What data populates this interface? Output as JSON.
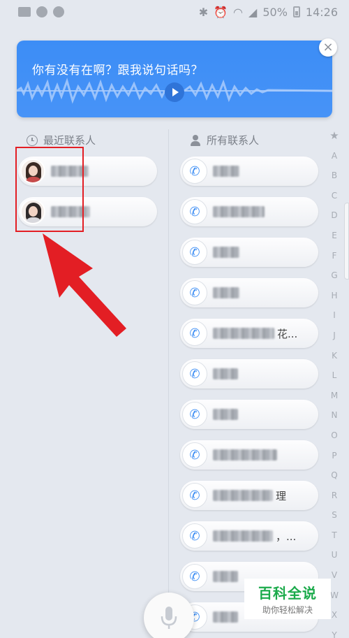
{
  "status_bar": {
    "battery": "50%",
    "time": "14:26",
    "left_icons": [
      "image-icon",
      "wechat-icon",
      "wechat-icon"
    ],
    "right_icons": [
      "bluetooth-icon",
      "alarm-icon",
      "wifi-icon",
      "signal-icon",
      "battery-icon"
    ]
  },
  "voice_card": {
    "text": "你有没有在啊？跟我说句话吗？",
    "accent": "#3c8df6"
  },
  "recent": {
    "header": "最近联系人",
    "items": [
      {
        "avatar": "avatar-woman-red"
      },
      {
        "avatar": "avatar-woman-white"
      }
    ]
  },
  "contacts": {
    "header": "所有联系人",
    "items": [
      {
        "tail": ""
      },
      {
        "tail": ""
      },
      {
        "tail": ""
      },
      {
        "tail": ""
      },
      {
        "tail": "花..."
      },
      {
        "tail": ""
      },
      {
        "tail": ""
      },
      {
        "tail": ""
      },
      {
        "tail": "理"
      },
      {
        "tail": "，..."
      },
      {
        "tail": ""
      },
      {
        "tail": ""
      }
    ]
  },
  "alphabet": [
    "★",
    "A",
    "B",
    "C",
    "D",
    "E",
    "F",
    "G",
    "H",
    "I",
    "J",
    "K",
    "L",
    "M",
    "N",
    "O",
    "P",
    "Q",
    "R",
    "S",
    "T",
    "U",
    "V",
    "W",
    "X",
    "Y"
  ],
  "watermark": {
    "title": "百科全说",
    "subtitle": "助你轻松解决"
  },
  "colors": {
    "annotation": "#e31e24",
    "phone_icon": "#3d8ef4",
    "watermark_green": "#1aaa4a"
  }
}
